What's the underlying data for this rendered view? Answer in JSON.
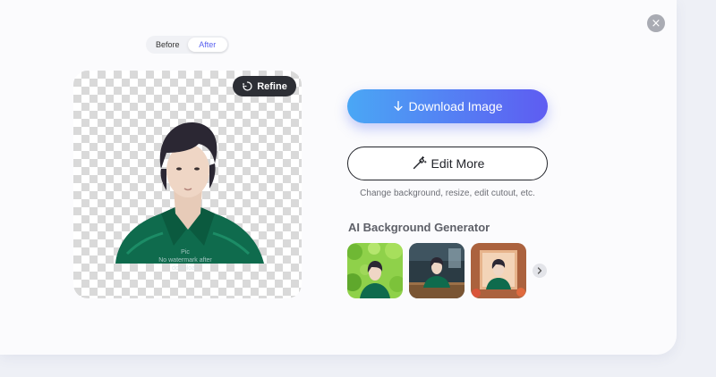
{
  "close_label": "×",
  "toggle": {
    "before": "Before",
    "after": "After",
    "selected": "After"
  },
  "preview": {
    "watermark_line1": "Pic",
    "watermark_line2": "No watermark after download"
  },
  "refine_label": "Refine",
  "download_label": "Download Image",
  "edit_label": "Edit More",
  "edit_hint": "Change background, resize, edit cutout, etc.",
  "ai_section": {
    "title": "AI Background Generator",
    "thumbnails": [
      {
        "name": "green-leaves-background",
        "accent": "#7cc23a"
      },
      {
        "name": "wooden-desk-background",
        "accent": "#6b4a2c"
      },
      {
        "name": "warm-frame-background",
        "accent": "#c27346"
      }
    ]
  },
  "colors": {
    "accent_start": "#4aa7f5",
    "accent_end": "#5e5cf2",
    "toggle_active_text": "#5b63f0",
    "dark_button": "#2d2f35"
  },
  "icons": {
    "close": "close-icon",
    "refine": "refine-icon",
    "download": "download-icon",
    "edit": "magic-wand-icon",
    "next": "chevron-right-icon"
  }
}
